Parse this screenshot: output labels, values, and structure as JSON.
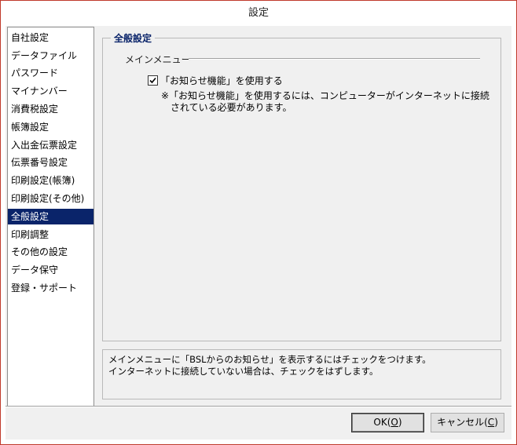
{
  "window": {
    "title": "設定"
  },
  "sidebar": {
    "items": [
      {
        "label": "自社設定"
      },
      {
        "label": "データファイル"
      },
      {
        "label": "パスワード"
      },
      {
        "label": "マイナンバー"
      },
      {
        "label": "消費税設定"
      },
      {
        "label": "帳簿設定"
      },
      {
        "label": "入出金伝票設定"
      },
      {
        "label": "伝票番号設定"
      },
      {
        "label": "印刷設定(帳簿)"
      },
      {
        "label": "印刷設定(その他)"
      },
      {
        "label": "全般設定",
        "selected": true
      },
      {
        "label": "印刷調整"
      },
      {
        "label": "その他の設定"
      },
      {
        "label": "データ保守"
      },
      {
        "label": "登録・サポート"
      }
    ]
  },
  "panel": {
    "group_title": "全般設定",
    "section_label": "メインメニュー",
    "checkbox": {
      "label": "「お知らせ機能」を使用する",
      "checked": true
    },
    "note_line1": "※「お知らせ機能」を使用するには、コンピューターがインターネットに接続",
    "note_line2": "されている必要があります。"
  },
  "description": {
    "line1": "メインメニューに「BSLからのお知らせ」を表示するにはチェックをつけます。",
    "line2": "インターネットに接続していない場合は、チェックをはずします。"
  },
  "buttons": {
    "ok_text": "OK(",
    "ok_key": "O",
    "cancel_text": "キャンセル(",
    "cancel_key": "C",
    "close_paren": ")"
  },
  "colors": {
    "selection": "#0a246a",
    "group_title": "#0a246a",
    "border": "#c0392b"
  },
  "icons": {
    "checkbox": "check-icon"
  }
}
